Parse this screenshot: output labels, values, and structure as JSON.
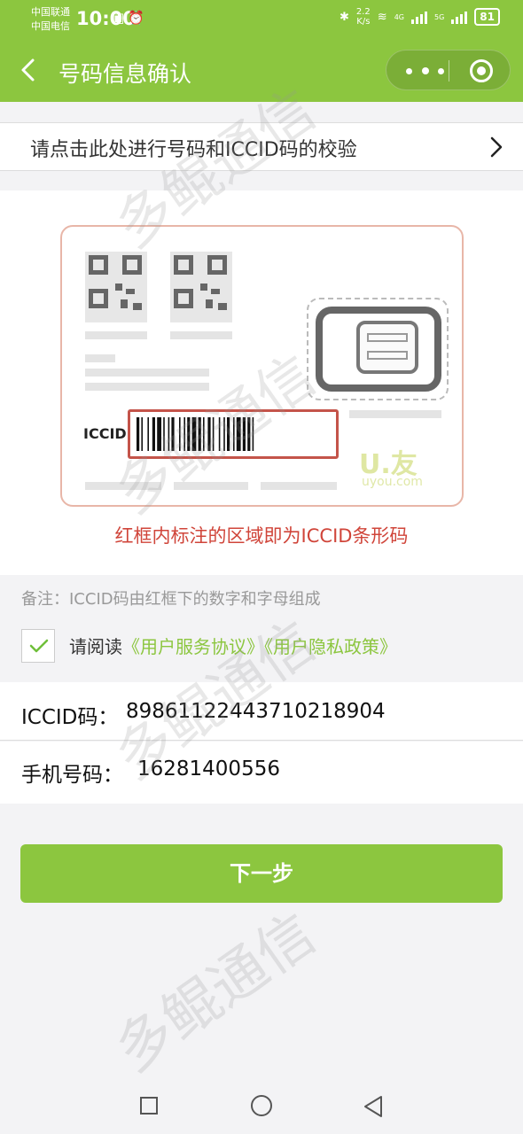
{
  "status_bar": {
    "carrier_1": "中国联通",
    "carrier_2": "中国电信",
    "time": "10:00",
    "net_speed_value": "2.2",
    "net_speed_unit": "K/s",
    "signal_1_label": "4G",
    "signal_2_label": "5G",
    "battery": "81"
  },
  "header": {
    "title": "号码信息确认",
    "back_icon": "chevron-left-icon",
    "more_icon": "more-dots-icon",
    "close_icon": "target-circle-icon"
  },
  "verify_row": {
    "label": "请点击此处进行号码和ICCID码的校验",
    "icon": "chevron-right-icon"
  },
  "sample_card": {
    "iccid_label": "ICCID",
    "logo_text": "U.友",
    "logo_sub": "uyou.com",
    "caption": "红框内标注的区域即为ICCID条形码"
  },
  "note": "备注：ICCID码由红框下的数字和字母组成",
  "agreement": {
    "checked": true,
    "prefix": "请阅读",
    "link_service": "《用户服务协议》",
    "link_privacy": "《用户隐私政策》"
  },
  "info": {
    "iccid_label": "ICCID码：",
    "iccid_value": "89861122443710218904",
    "phone_label": "手机号码：",
    "phone_value": "16281400556"
  },
  "next_button": "下一步",
  "watermark": "多鲲通信",
  "colors": {
    "brand_green": "#8cc63f",
    "highlight_red": "#c4544a",
    "caption_red": "#d0453a"
  }
}
